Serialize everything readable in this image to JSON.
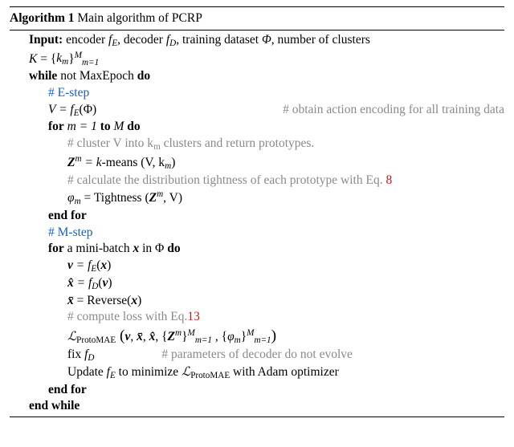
{
  "algo": {
    "number": "Algorithm 1",
    "title": "Main algorithm of PCRP",
    "input_label": "Input:",
    "input_body_a": " encoder ",
    "input_fE": "f",
    "input_fE_sub": "E",
    "input_body_b": ", decoder ",
    "input_fD": "f",
    "input_fD_sub": "D",
    "input_body_c": ", training dataset ",
    "input_phi": "Φ",
    "input_body_d": ", number of clusters",
    "input_K_line_a": "K",
    "input_K_line_b": " = {",
    "input_km": "k",
    "input_km_sub": "m",
    "input_K_line_c": "}",
    "input_K_sup": "M",
    "input_K_sub": "m=1",
    "while_a": "while",
    "while_b": " not MaxEpoch ",
    "do": "do",
    "estep": "# E-step",
    "v_eq": "V = f",
    "v_eq_sub": "E",
    "v_eq_b": "(Φ)",
    "v_cmt": "# obtain action encoding for all training data",
    "for1_a": "for",
    "for1_b": " m = 1 ",
    "for1_c": "to",
    "for1_d": " M ",
    "cluster_cmt": "# cluster V into k",
    "cluster_cmt_sub": "m",
    "cluster_cmt_b": " clusters and return prototypes.",
    "zm_a": "Z",
    "zm_sup": "m",
    "zm_b": " = k",
    "zm_c": "-means",
    "zm_d": " (V, k",
    "zm_d_sub": "m",
    "zm_e": ")",
    "tight_cmt": "# calculate the distribution tightness of each prototype with Eq. ",
    "tight_cmt_eq": "8",
    "phim_a": "φ",
    "phim_sub": "m",
    "phim_b": " = Tightness (",
    "phim_c": "Z",
    "phim_c_sup": "m",
    "phim_d": ", V)",
    "endfor": "end for",
    "mstep": "# M-step",
    "for2_a": "for",
    "for2_b": " a mini-batch ",
    "for2_x": "x",
    "for2_c": " in Φ ",
    "v2_a": "v",
    "v2_b": " = f",
    "v2_sub": "E",
    "v2_c": "(",
    "v2_x": "x",
    "v2_d": ")",
    "xhat_a": "x̂",
    "xhat_b": " = f",
    "xhat_sub": "D",
    "xhat_c": "(",
    "xhat_v": "v",
    "xhat_d": ")",
    "xbar_a": "x̄",
    "xbar_b": " = Reverse(",
    "xbar_x": "x",
    "xbar_c": ")",
    "loss_cmt": "# compute loss with Eq.",
    "loss_cmt_eq": "13",
    "L_a": "ℒ",
    "L_sub": "ProtoMAE",
    "L_open": " (",
    "L_v": "v",
    "L_c1": ", ",
    "L_xbar": "x̄",
    "L_c2": ", ",
    "L_xhat": "x̂",
    "L_c3": ", {",
    "L_Zm": "Z",
    "L_Zm_sup": "m",
    "L_c4": "}",
    "L_setM_sup": "M",
    "L_setM_sub": "m=1",
    "L_c5": " , {",
    "L_phim": "φ",
    "L_phim_sub": "m",
    "L_c6": "}",
    "L_close": ")",
    "fix_a": "fix ",
    "fix_fd": "f",
    "fix_fd_sub": "D",
    "fix_cmt": "# parameters of decoder do not evolve",
    "update_a": "Update ",
    "update_fe": "f",
    "update_fe_sub": "E",
    "update_b": " to minimize ",
    "update_L": "ℒ",
    "update_L_sub": "ProtoMAE",
    "update_c": " with Adam optimizer",
    "endwhile": "end while"
  }
}
